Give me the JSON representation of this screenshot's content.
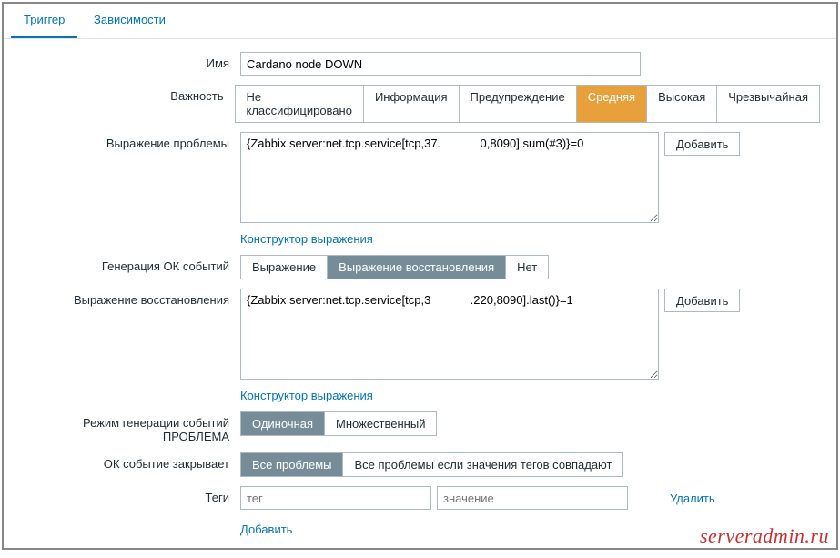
{
  "tabs": {
    "trigger": "Триггер",
    "dependencies": "Зависимости"
  },
  "labels": {
    "name": "Имя",
    "severity": "Важность",
    "problem_expr": "Выражение проблемы",
    "ok_gen": "Генерация ОК событий",
    "recovery_expr": "Выражение восстановления",
    "problem_mode": "Режим генерации событий ПРОБЛЕМА",
    "ok_close": "ОК событие закрывает",
    "tags": "Теги"
  },
  "name_value": "Cardano node DOWN",
  "severity": {
    "options": [
      "Не классифицировано",
      "Информация",
      "Предупреждение",
      "Средняя",
      "Высокая",
      "Чрезвычайная"
    ],
    "selected": 3
  },
  "problem_expr": "{Zabbix server:net.tcp.service[tcp,37.            0,8090].sum(#3)}=0",
  "recovery_expr": "{Zabbix server:net.tcp.service[tcp,3            .220,8090].last()}=1",
  "buttons": {
    "add": "Добавить",
    "expr_constructor": "Конструктор выражения",
    "tag_remove": "Удалить",
    "tag_add": "Добавить"
  },
  "ok_gen": {
    "options": [
      "Выражение",
      "Выражение восстановления",
      "Нет"
    ],
    "selected": 1
  },
  "problem_mode": {
    "options": [
      "Одиночная",
      "Множественный"
    ],
    "selected": 0
  },
  "ok_close": {
    "options": [
      "Все проблемы",
      "Все проблемы если значения тегов совпадают"
    ],
    "selected": 0
  },
  "tags": {
    "tag_placeholder": "тег",
    "value_placeholder": "значение"
  },
  "watermark": "serveradmin.ru"
}
